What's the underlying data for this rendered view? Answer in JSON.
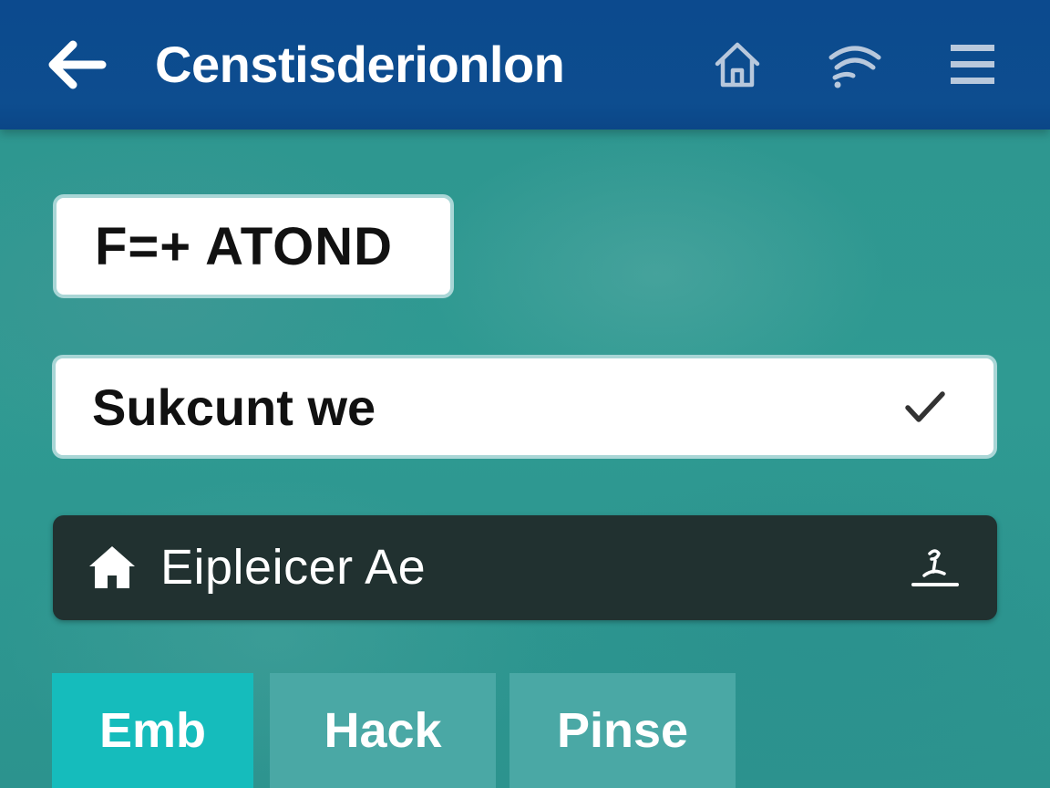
{
  "header": {
    "title": "Censtisderionlon",
    "back_icon": "arrow-left-icon",
    "icons": [
      "home-icon",
      "wifi-icon",
      "menu-icon"
    ]
  },
  "badge": {
    "label": "F=+ ATOND"
  },
  "select_field": {
    "value": "Sukcunt we",
    "icon": "checkmark-icon"
  },
  "dark_row": {
    "label": "Eipleicer Ae",
    "leading_icon": "home-icon",
    "trailing_icon": "sprout-icon"
  },
  "tabs": [
    {
      "label": "Emb",
      "active": true
    },
    {
      "label": "Hack",
      "active": false
    },
    {
      "label": "Pinse",
      "active": false
    }
  ],
  "colors": {
    "header_bg": "#0d4d8f",
    "body_bg": "#2f9990",
    "active_tab": "#15bcbc",
    "inactive_tab": "#4aa8a5",
    "dark_row_bg": "#213130"
  }
}
